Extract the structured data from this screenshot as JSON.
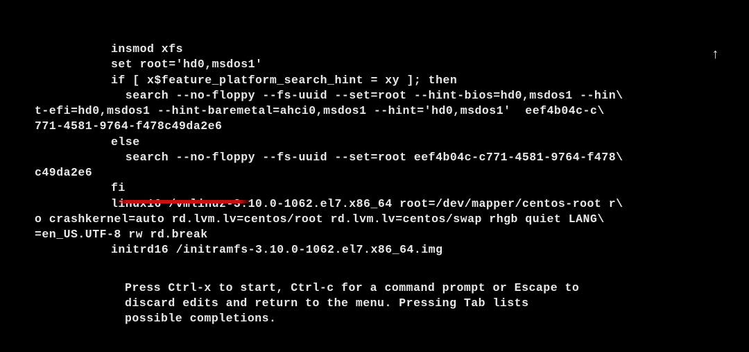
{
  "arrow": "↑",
  "config": {
    "ln1": "insmod xfs",
    "ln2": "set root='hd0,msdos1'",
    "ln3": "if [ x$feature_platform_search_hint = xy ]; then",
    "ln4": "  search --no-floppy --fs-uuid --set=root --hint-bios=hd0,msdos1 --hin\\",
    "ln5": "t-efi=hd0,msdos1 --hint-baremetal=ahci0,msdos1 --hint='hd0,msdos1'  eef4b04c-c\\",
    "ln6": "771-4581-9764-f478c49da2e6",
    "ln7": "else",
    "ln8": "  search --no-floppy --fs-uuid --set=root eef4b04c-c771-4581-9764-f478\\",
    "ln9": "c49da2e6",
    "ln10": "fi",
    "ln11": "linux16 /vmlinuz-3.10.0-1062.el7.x86_64 root=/dev/mapper/centos-root r\\",
    "ln12": "o crashkernel=auto rd.lvm.lv=centos/root rd.lvm.lv=centos/swap rhgb quiet LANG\\",
    "ln13": "=en_US.UTF-8 rw rd.break",
    "ln14": "initrd16 /initramfs-3.10.0-1062.el7.x86_64.img"
  },
  "annotation": {
    "highlighted_text": "rw rd.break",
    "meaning": "appended_boot_params"
  },
  "help": {
    "l1": "Press Ctrl-x to start, Ctrl-c for a command prompt or Escape to",
    "l2": "discard edits and return to the menu. Pressing Tab lists",
    "l3": "possible completions."
  }
}
